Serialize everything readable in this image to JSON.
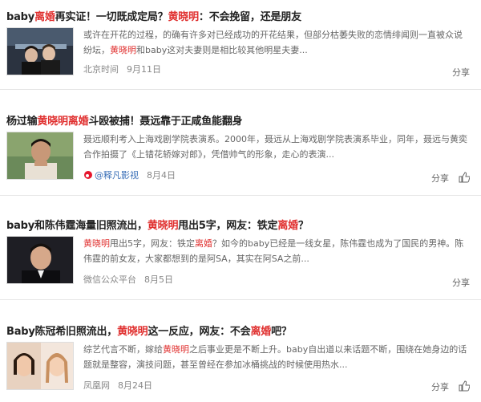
{
  "items": [
    {
      "title_parts": [
        "baby",
        "离婚",
        "再实证！一切既成定局？",
        "黄晓明",
        "：不会挽留，还是朋友"
      ],
      "desc_parts": [
        "或许在开花的过程，的确有许多对已经成功的开花结果，但部分枯萎失败的恋情绯闻则一直被众说纷坛，",
        "黄晓明",
        "和baby这对夫妻则是相比较其他明星夫妻..."
      ],
      "source": "北京时间",
      "date": "9月11日",
      "share_label": "分享"
    },
    {
      "title_parts": [
        "杨过输",
        "黄晓明离婚",
        "斗殴被捕！聂远靠于正咸鱼能翻身"
      ],
      "desc_parts": [
        "聂远顺利考入上海戏剧学院表演系。2000年，聂远从上海戏剧学院表演系毕业，同年，聂远与黄奕合作拍摄了《上错花轿嫁对郎》，凭借帅气的形象，走心的表演..."
      ],
      "source": "@释凡影视",
      "date": "8月4日",
      "share_label": "分享"
    },
    {
      "title_parts": [
        "baby和陈伟霆海量旧照流出，",
        "黄晓明",
        "甩出5字，网友：铁定",
        "离婚",
        "？"
      ],
      "desc_parts": [
        "黄晓明",
        "甩出5字，网友：铁定",
        "离婚",
        "？如今的baby已经是一线女星，陈伟霆也成为了国民的男神。陈伟霆的前女友，大家都想到的是阿SA，其实在阿SA之前..."
      ],
      "source": "微信公众平台",
      "date": "8月5日",
      "share_label": "分享"
    },
    {
      "title_parts": [
        "Baby陈冠希旧照流出，",
        "黄晓明",
        "这一反应，网友：不会",
        "离婚",
        "吧？"
      ],
      "desc_parts": [
        "综艺代言不断，嫁给",
        "黄晓明",
        "之后事业更是不断上升。baby自出道以来话题不断，围绕在她身边的话题就是整容，演技问题，甚至曾经在参加冰桶挑战的时候使用热水..."
      ],
      "source": "凤凰网",
      "date": "8月24日",
      "share_label": "分享"
    }
  ],
  "colors": {
    "highlight": "#e0302f",
    "link": "#3a6fb7"
  },
  "icons": [
    "thumbs-up-icon",
    "weibo-icon"
  ]
}
